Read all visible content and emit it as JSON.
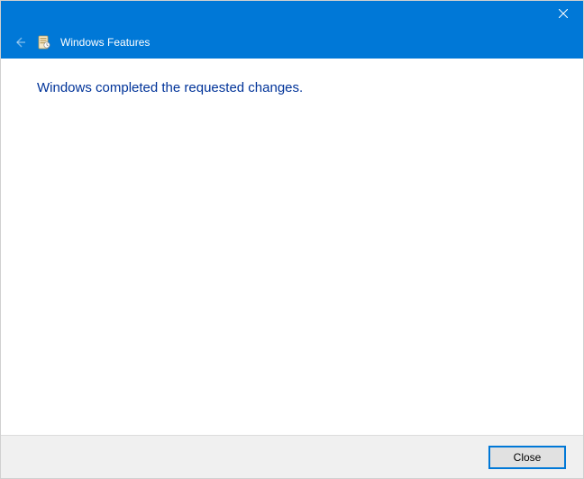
{
  "titlebar": {
    "close_tooltip": "Close"
  },
  "header": {
    "title": "Windows Features"
  },
  "content": {
    "message": "Windows completed the requested changes."
  },
  "footer": {
    "close_label": "Close"
  }
}
